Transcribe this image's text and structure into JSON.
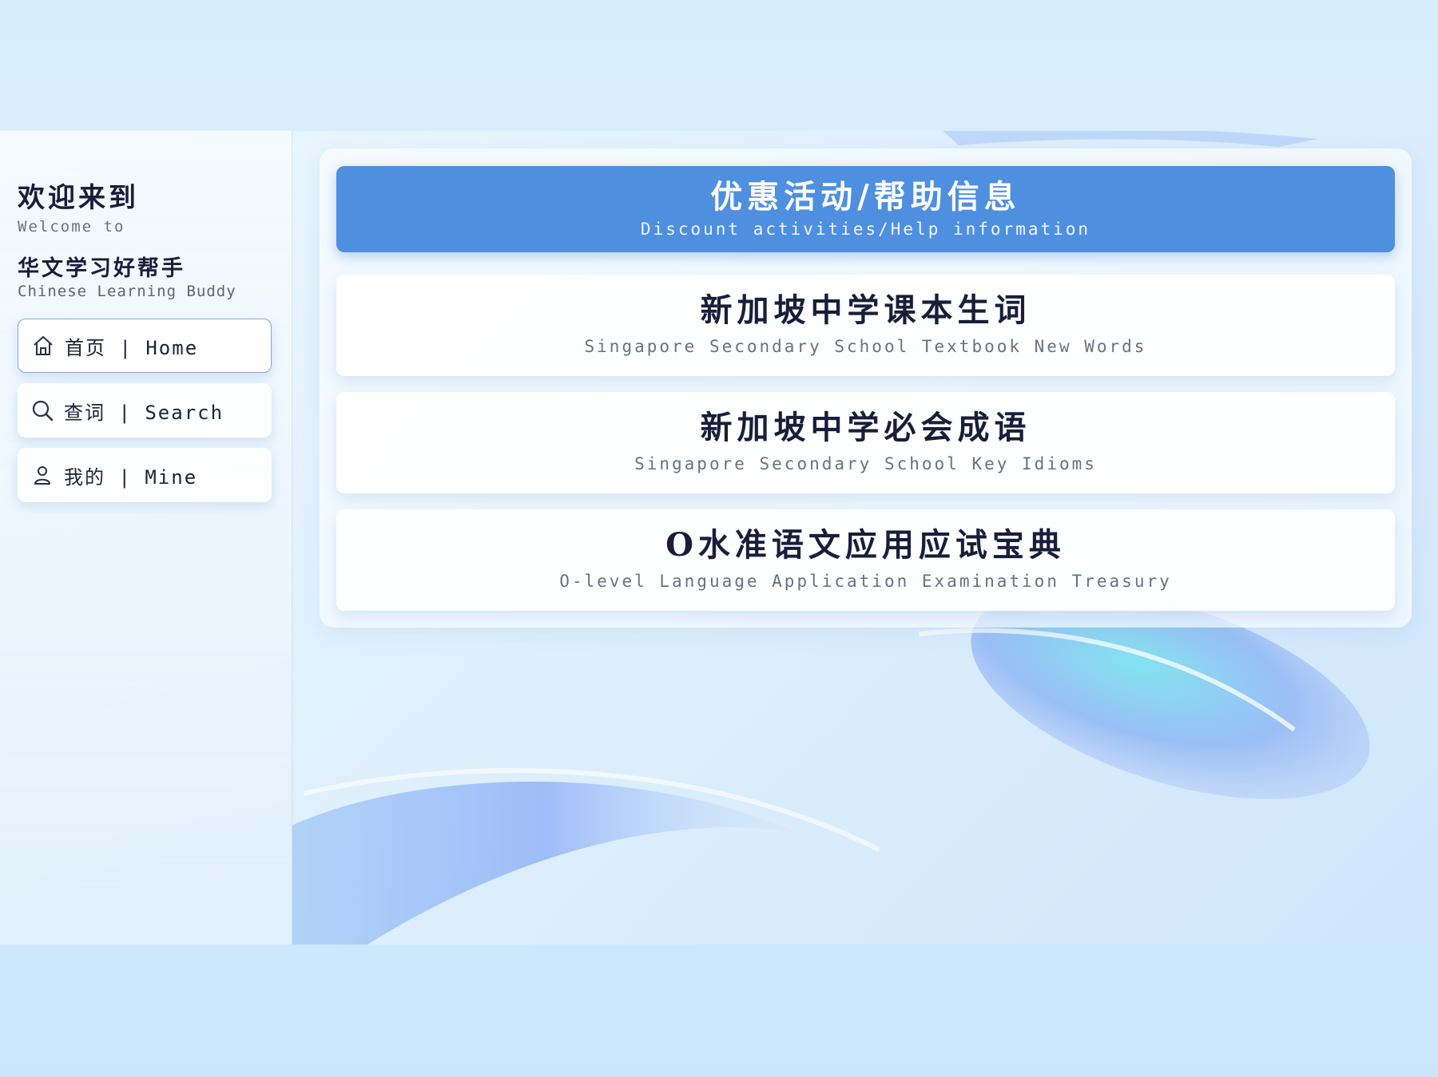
{
  "sidebar": {
    "welcome_cn": "欢迎来到",
    "welcome_en": "Welcome to",
    "app_name_cn": "华文学习好帮手",
    "app_name_en": "Chinese Learning Buddy",
    "nav": [
      {
        "label": "首页 | Home",
        "icon": "home-icon",
        "active": true
      },
      {
        "label": "查词 | Search",
        "icon": "search-icon",
        "active": false
      },
      {
        "label": "我的 | Mine",
        "icon": "user-icon",
        "active": false
      }
    ]
  },
  "cards": [
    {
      "title": "优惠活动/帮助信息",
      "subtitle": "Discount activities/Help information",
      "highlighted": true
    },
    {
      "title": "新加坡中学课本生词",
      "subtitle": "Singapore Secondary School Textbook New Words",
      "highlighted": false
    },
    {
      "title": "新加坡中学必会成语",
      "subtitle": "Singapore Secondary School Key Idioms",
      "highlighted": false
    },
    {
      "title": "O水准语文应用应试宝典",
      "subtitle": "O-level Language Application Examination Treasury",
      "highlighted": false
    }
  ],
  "colors": {
    "accent": "#4f8fdf",
    "text_dark": "#1a1d3a",
    "text_muted": "#6b7080"
  }
}
